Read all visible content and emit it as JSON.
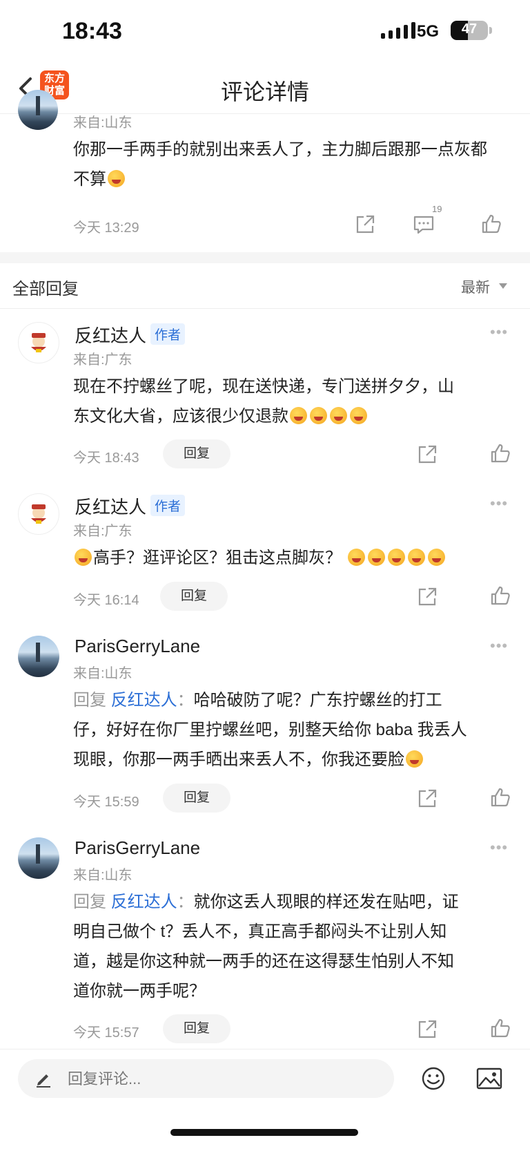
{
  "status": {
    "time": "18:43",
    "network": "5G",
    "battery": "47",
    "battery_level": 0.47
  },
  "nav": {
    "title": "评论详情",
    "logo_line1": "东方",
    "logo_line2": "财富"
  },
  "main_comment": {
    "from": "来自:山东",
    "text": "你那一手两手的就别出来丢人了，主力脚后跟那一点灰都不算",
    "time": "今天 13:29",
    "comment_count": "19"
  },
  "replies_header": {
    "title": "全部回复",
    "sort": "最新"
  },
  "replies": [
    {
      "name": "反红达人",
      "tag": "作者",
      "from": "来自:广东",
      "time": "今天 18:43",
      "reply_label": "回复",
      "line1": "现在不拧螺丝了呢，现在送快递，专门送拼夕夕，山",
      "line2": "东文化大省，应该很少仅退款"
    },
    {
      "name": "反红达人",
      "tag": "作者",
      "from": "来自:广东",
      "time": "今天 16:14",
      "reply_label": "回复",
      "line1": "高手？逛评论区？狙击这点脚灰？"
    },
    {
      "name": "ParisGerryLane",
      "from": "来自:山东",
      "time": "今天 15:59",
      "reply_label": "回复",
      "prefix": "回复",
      "at": "反红达人",
      "colon": "：",
      "line1": "哈哈破防了呢？广东拧螺丝的打工",
      "line2": "仔，好好在你厂里拧螺丝吧，别整天给你 baba 我丢人",
      "line3": "现眼，你那一两手晒出来丢人不，你我还要脸"
    },
    {
      "name": "ParisGerryLane",
      "from": "来自:山东",
      "time": "今天 15:57",
      "reply_label": "回复",
      "prefix": "回复",
      "at": "反红达人",
      "colon": "：",
      "line1": "就你这丢人现眼的样还发在贴吧，证",
      "line2": "明自己做个 t？丢人不，真正高手都闷头不让别人知",
      "line3": "道，越是你这种就一两手的还在这得瑟生怕别人不知",
      "line4": "道你就一两手呢？"
    }
  ],
  "input": {
    "placeholder": "回复评论..."
  }
}
